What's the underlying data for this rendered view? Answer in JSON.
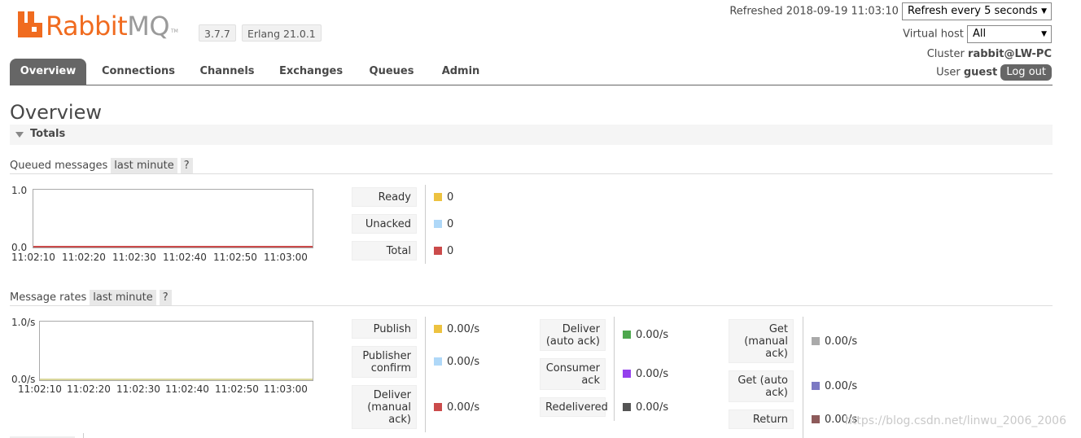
{
  "header": {
    "logo_text": "Rabbit",
    "logo_text_mq": "MQ",
    "logo_tm": "TM",
    "version": "3.7.7",
    "erlang": "Erlang 21.0.1",
    "refreshed_label": "Refreshed 2018-09-19 11:03:10",
    "refresh_select": "Refresh every 5 seconds",
    "vhost_label": "Virtual host",
    "vhost_select": "All",
    "cluster_label": "Cluster",
    "cluster_value": "rabbit@LW-PC",
    "user_label": "User",
    "user_value": "guest",
    "logout_label": "Log out"
  },
  "tabs": [
    "Overview",
    "Connections",
    "Channels",
    "Exchanges",
    "Queues",
    "Admin"
  ],
  "page_title": "Overview",
  "totals_label": "Totals",
  "queued": {
    "title": "Queued messages",
    "range": "last minute",
    "help": "?",
    "y_top": "1.0",
    "y_bottom": "0.0",
    "x_labels": [
      "11:02:10",
      "11:02:20",
      "11:02:30",
      "11:02:40",
      "11:02:50",
      "11:03:00"
    ],
    "items": [
      {
        "label": "Ready",
        "value": "0",
        "color": "#edc240"
      },
      {
        "label": "Unacked",
        "value": "0",
        "color": "#afd8f8"
      },
      {
        "label": "Total",
        "value": "0",
        "color": "#cb4b4b"
      }
    ]
  },
  "rates": {
    "title": "Message rates",
    "range": "last minute",
    "help": "?",
    "y_top": "1.0/s",
    "y_bottom": "0.0/s",
    "x_labels": [
      "11:02:10",
      "11:02:20",
      "11:02:30",
      "11:02:40",
      "11:02:50",
      "11:03:00"
    ],
    "col1": [
      {
        "label": "Publish",
        "value": "0.00/s",
        "color": "#edc240"
      },
      {
        "label": "Publisher confirm",
        "value": "0.00/s",
        "color": "#afd8f8"
      },
      {
        "label": "Deliver (manual ack)",
        "value": "0.00/s",
        "color": "#cb4b4b"
      }
    ],
    "col2": [
      {
        "label": "Deliver (auto ack)",
        "value": "0.00/s",
        "color": "#4da74d"
      },
      {
        "label": "Consumer ack",
        "value": "0.00/s",
        "color": "#9440ed"
      },
      {
        "label": "Redelivered",
        "value": "0.00/s",
        "color": "#545454"
      }
    ],
    "col3": [
      {
        "label": "Get (manual ack)",
        "value": "0.00/s",
        "color": "#aaaaaa"
      },
      {
        "label": "Get (auto ack)",
        "value": "0.00/s",
        "color": "#7c79c3"
      },
      {
        "label": "Return",
        "value": "0.00/s",
        "color": "#8d5a5a"
      }
    ]
  },
  "watermark": "https://blog.csdn.net/linwu_2006_2006"
}
